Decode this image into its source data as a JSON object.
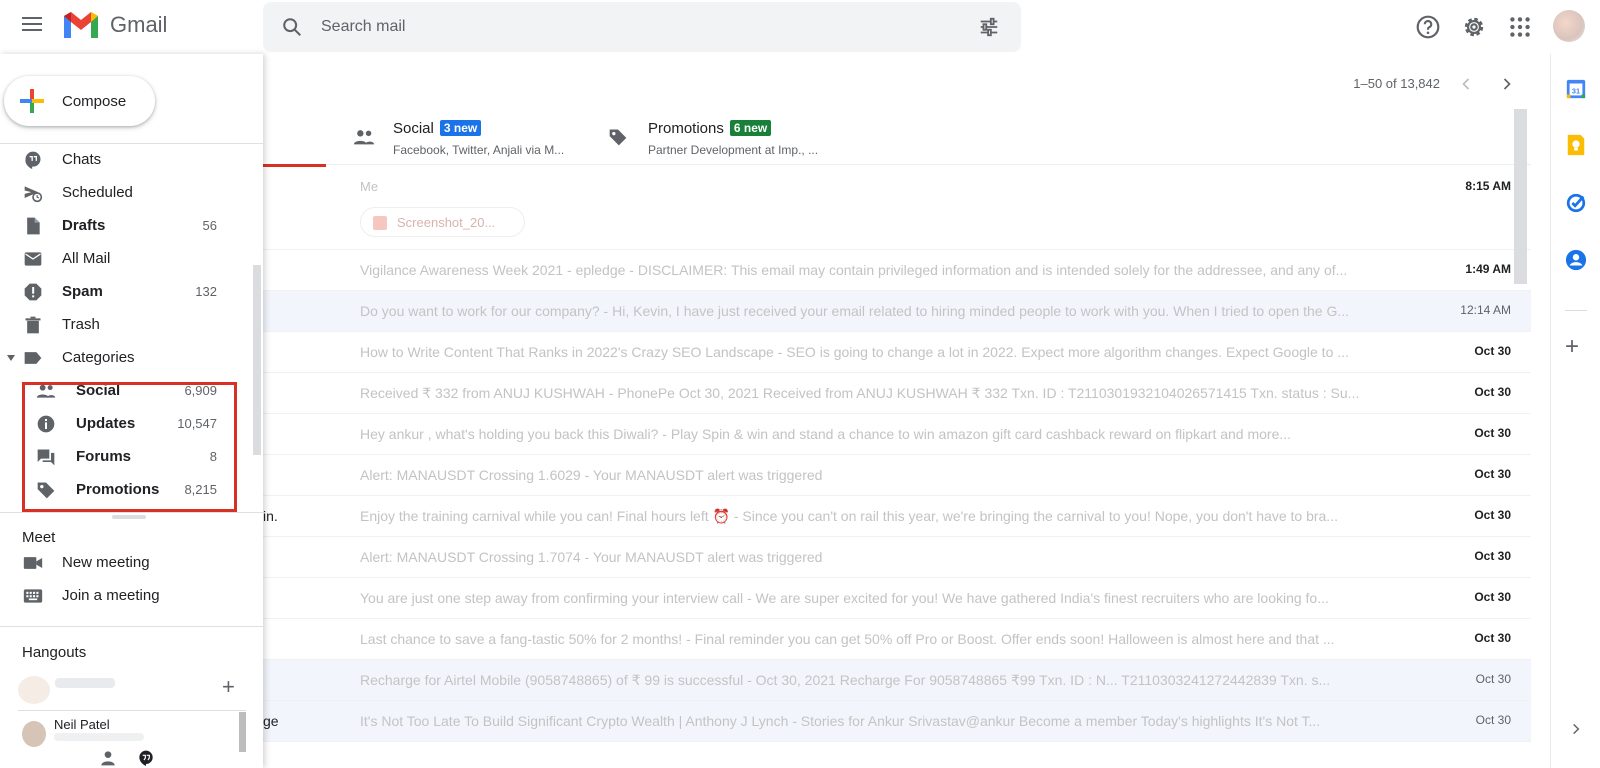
{
  "app": {
    "name": "Gmail",
    "brand_colors": {
      "red": "#ea4335",
      "blue": "#4285f4",
      "green": "#34a853",
      "yellow": "#fbbc04"
    }
  },
  "search": {
    "placeholder": "Search mail"
  },
  "header_icons": [
    "support-icon",
    "settings-icon",
    "apps-grid-icon",
    "account-avatar"
  ],
  "sidebar": {
    "compose_label": "Compose",
    "items": [
      {
        "id": "chats",
        "label": "Chats",
        "count": "",
        "bold": false,
        "icon": "chat-bubble-icon"
      },
      {
        "id": "scheduled",
        "label": "Scheduled",
        "count": "",
        "bold": false,
        "icon": "scheduled-send-icon"
      },
      {
        "id": "drafts",
        "label": "Drafts",
        "count": "56",
        "bold": true,
        "icon": "draft-icon"
      },
      {
        "id": "all-mail",
        "label": "All Mail",
        "count": "",
        "bold": false,
        "icon": "mail-icon"
      },
      {
        "id": "spam",
        "label": "Spam",
        "count": "132",
        "bold": true,
        "icon": "spam-icon"
      },
      {
        "id": "trash",
        "label": "Trash",
        "count": "",
        "bold": false,
        "icon": "trash-icon"
      },
      {
        "id": "categories",
        "label": "Categories",
        "count": "",
        "bold": false,
        "icon": "label-icon"
      }
    ],
    "categories": [
      {
        "id": "social",
        "label": "Social",
        "count": "6,909",
        "icon": "people-icon"
      },
      {
        "id": "updates",
        "label": "Updates",
        "count": "10,547",
        "icon": "info-icon"
      },
      {
        "id": "forums",
        "label": "Forums",
        "count": "8",
        "icon": "forum-icon"
      },
      {
        "id": "promotions",
        "label": "Promotions",
        "count": "8,215",
        "icon": "tag-icon"
      }
    ],
    "highlight_color": "#d93025",
    "meet": {
      "title": "Meet",
      "items": [
        {
          "label": "New meeting",
          "icon": "video-camera-icon"
        },
        {
          "label": "Join a meeting",
          "icon": "keyboard-icon"
        }
      ]
    },
    "hangouts": {
      "title": "Hangouts",
      "contact_name": "Neil Patel"
    }
  },
  "main": {
    "pagination": "1–50 of 13,842",
    "tabs": [
      {
        "name": "Social",
        "badge": "3 new",
        "badge_color": "#1a73e8",
        "sub": "Facebook, Twitter, Anjali via M...",
        "icon": "people-icon"
      },
      {
        "name": "Promotions",
        "badge": "6 new",
        "badge_color": "#188038",
        "sub": "Partner Development at Imp., ...",
        "icon": "tag-icon"
      }
    ],
    "emails": [
      {
        "left": "",
        "sender": "Me",
        "attachment": "Screenshot_20...",
        "content": "",
        "date": "8:15 AM",
        "read": false
      },
      {
        "left": "",
        "content": "Vigilance Awareness Week 2021 - epledge - DISCLAIMER: This email may contain privileged information and is intended solely for the addressee, and any of...",
        "date": "1:49 AM",
        "read": false
      },
      {
        "left": "",
        "content": "Do you want to work for our company? - Hi, Kevin, I have just received your email related to hiring minded people to work with you. When I tried to open the G...",
        "date": "12:14 AM",
        "read": true
      },
      {
        "left": "",
        "content": "How to Write Content That Ranks in 2022's Crazy SEO Landscape - SEO is going to change a lot in 2022. Expect more algorithm changes. Expect Google to ...",
        "date": "Oct 30",
        "read": false
      },
      {
        "left": "",
        "content": "Received ₹ 332 from ANUJ KUSHWAH - PhonePe Oct 30, 2021 Received from ANUJ KUSHWAH ₹ 332 Txn. ID : T2110301932104026571415 Txn. status : Su...",
        "date": "Oct 30",
        "read": false
      },
      {
        "left": "",
        "content": "Hey ankur , what's holding you back this Diwali? - Play Spin & win and stand a chance to win amazon gift card cashback reward on flipkart and more...",
        "date": "Oct 30",
        "read": false
      },
      {
        "left": "",
        "content": "Alert: MANAUSDT Crossing 1.6029 - Your MANAUSDT alert was triggered",
        "date": "Oct 30",
        "read": false
      },
      {
        "left": "in.",
        "content": "Enjoy the training carnival while you can! Final hours left ⏰ - Since you can't on rail this year, we're bringing the carnival to you! Nope, you don't have to bra...",
        "date": "Oct 30",
        "read": false
      },
      {
        "left": "",
        "content": "Alert: MANAUSDT Crossing 1.7074 - Your MANAUSDT alert was triggered",
        "date": "Oct 30",
        "read": false
      },
      {
        "left": "",
        "content": "You are just one step away from confirming your interview call - We are super excited for you! We have gathered India's finest recruiters who are looking fo...",
        "date": "Oct 30",
        "read": false
      },
      {
        "left": "",
        "content": "Last chance to save a fang-tastic 50% for 2 months! - Final reminder you can get 50% off Pro or Boost. Offer ends soon! Halloween is almost here and that ...",
        "date": "Oct 30",
        "read": false
      },
      {
        "left": "",
        "content": "Recharge for Airtel Mobile (9058748865) of ₹ 99 is successful - Oct 30, 2021 Recharge For 9058748865 ₹99 Txn. ID : N... T2110303241272442839 Txn. s...",
        "date": "Oct 30",
        "read": true
      },
      {
        "left": "ge",
        "content": "It's Not Too Late To Build Significant Crypto Wealth | Anthony J Lynch - Stories for Ankur Srivastav@ankur Become a member Today's highlights It's Not T...",
        "date": "Oct 30",
        "read": true
      }
    ]
  },
  "right_rail": [
    "calendar-icon",
    "keep-icon",
    "tasks-icon",
    "contacts-icon",
    "add-icon",
    "expand-icon"
  ]
}
